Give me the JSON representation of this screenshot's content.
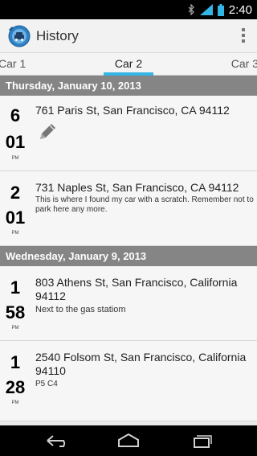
{
  "status_bar": {
    "time": "2:40",
    "icons": [
      "bluetooth-icon",
      "signal-icon",
      "battery-icon"
    ],
    "color": "#000000"
  },
  "action_bar": {
    "title": "History",
    "icon": "car-pin-icon",
    "overflow_icon": "overflow-menu-icon"
  },
  "tabs": {
    "items": [
      {
        "label": "Car 1",
        "selected": false
      },
      {
        "label": "Car 2",
        "selected": true
      },
      {
        "label": "Car 3",
        "selected": false
      }
    ],
    "accent": "#33b5e5"
  },
  "sections": [
    {
      "date": "Thursday, January 10, 2013",
      "entries": [
        {
          "hour": "6",
          "minute": "01",
          "ampm": "PM",
          "address": "761 Paris St, San Francisco, CA 94112",
          "note": "",
          "edit_icon": "pencil-icon"
        },
        {
          "hour": "2",
          "minute": "01",
          "ampm": "PM",
          "address": "731 Naples St, San Francisco, CA 94112",
          "note": "This is where I found my car with a scratch. Remember not to park here any more."
        }
      ]
    },
    {
      "date": "Wednesday, January 9, 2013",
      "entries": [
        {
          "hour": "1",
          "minute": "58",
          "ampm": "PM",
          "address": "803 Athens St, San Francisco, California 94112",
          "note": "Next to the gas statiom"
        },
        {
          "hour": "1",
          "minute": "28",
          "ampm": "PM",
          "address": "2540 Folsom St, San Francisco, California 94110",
          "note": "P5 C4"
        }
      ]
    }
  ],
  "nav_bar": {
    "buttons": [
      "back-icon",
      "home-icon",
      "recent-apps-icon"
    ]
  }
}
